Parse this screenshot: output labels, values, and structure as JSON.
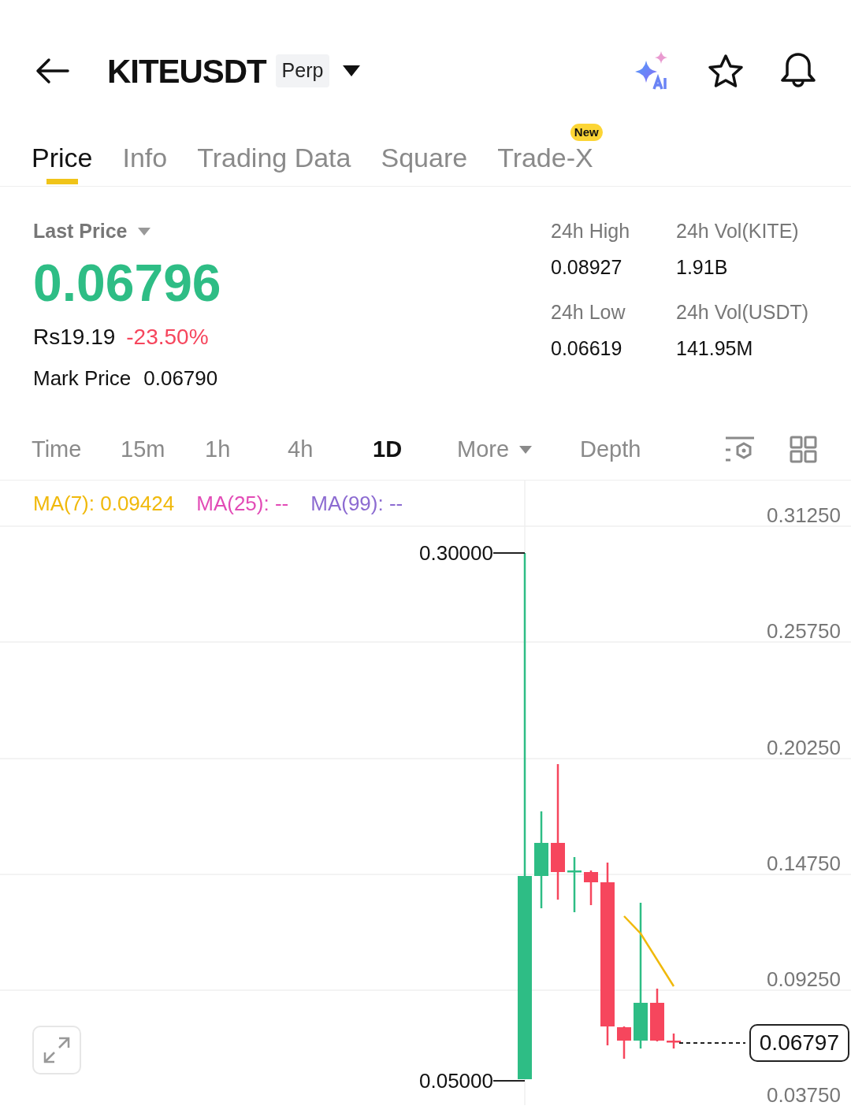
{
  "header": {
    "symbol": "KITEUSDT",
    "badge": "Perp"
  },
  "tabs": [
    {
      "label": "Price",
      "selected": true
    },
    {
      "label": "Info",
      "selected": false
    },
    {
      "label": "Trading Data",
      "selected": false
    },
    {
      "label": "Square",
      "selected": false
    },
    {
      "label": "Trade-X",
      "selected": false,
      "badge": "New"
    }
  ],
  "last_price": {
    "label": "Last Price",
    "value": "0.06796",
    "fiat": "Rs19.19",
    "change": "-23.50%",
    "mark_label": "Mark Price",
    "mark_value": "0.06790"
  },
  "stats": [
    {
      "label": "24h High",
      "value": "0.08927"
    },
    {
      "label": "24h Vol(KITE)",
      "value": "1.91B"
    },
    {
      "label": "24h Low",
      "value": "0.06619"
    },
    {
      "label": "24h Vol(USDT)",
      "value": "141.95M"
    }
  ],
  "intervals": [
    {
      "label": "Time",
      "selected": false,
      "kind": "option"
    },
    {
      "label": "15m",
      "selected": false,
      "kind": "option"
    },
    {
      "label": "1h",
      "selected": false,
      "kind": "option"
    },
    {
      "label": "4h",
      "selected": false,
      "kind": "option"
    },
    {
      "label": "1D",
      "selected": true,
      "kind": "option"
    },
    {
      "label": "More",
      "selected": false,
      "kind": "dropdown"
    },
    {
      "label": "Depth",
      "selected": false,
      "kind": "option"
    }
  ],
  "chart": {
    "ma": [
      {
        "label": "MA(7): 0.09424",
        "color": "#f0b90b"
      },
      {
        "label": "MA(25): --",
        "color": "#e24bb6"
      },
      {
        "label": "MA(99): --",
        "color": "#8c6bd1"
      }
    ],
    "y_axis": [
      "0.31250",
      "0.25750",
      "0.20250",
      "0.14750",
      "0.09250",
      "0.03750"
    ],
    "high_label": "0.30000",
    "low_label": "0.05000",
    "last_price": "0.06797"
  }
}
